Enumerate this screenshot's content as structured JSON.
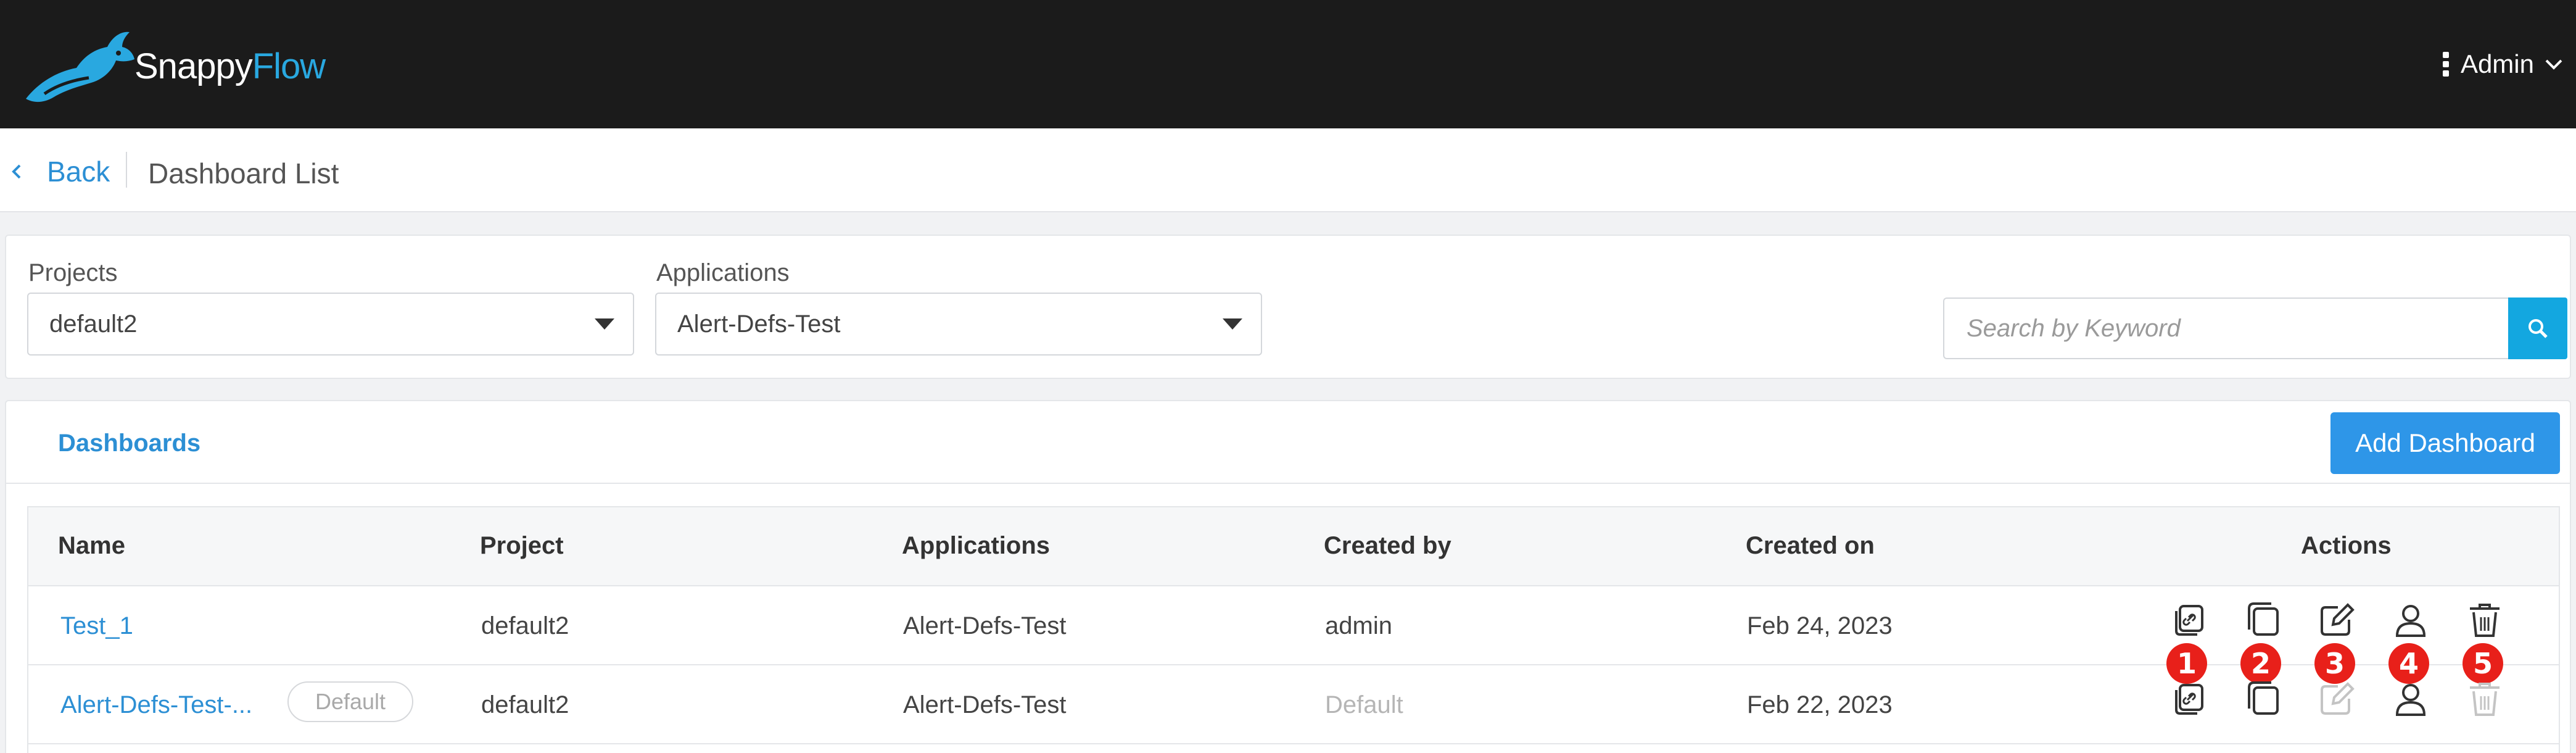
{
  "header": {
    "brand_part1": "Snappy",
    "brand_part2": "Flow",
    "user_label": "Admin"
  },
  "breadcrumb": {
    "back_label": "Back",
    "page_title": "Dashboard List"
  },
  "filters": {
    "projects_label": "Projects",
    "projects_value": "default2",
    "applications_label": "Applications",
    "applications_value": "Alert-Defs-Test",
    "search_placeholder": "Search by Keyword"
  },
  "dashboards": {
    "tab_label": "Dashboards",
    "add_button_label": "Add Dashboard",
    "columns": [
      "Name",
      "Project",
      "Applications",
      "Created by",
      "Created on",
      "Actions"
    ],
    "rows": [
      {
        "name": "Test_1",
        "badge": "",
        "project": "default2",
        "applications": "Alert-Defs-Test",
        "created_by": "admin",
        "created_on": "Feb 24, 2023"
      },
      {
        "name": "Alert-Defs-Test-...",
        "badge": "Default",
        "project": "default2",
        "applications": "Alert-Defs-Test",
        "created_by": "Default",
        "created_on": "Feb 22, 2023"
      }
    ],
    "action_icons": [
      "copy-link-icon",
      "duplicate-icon",
      "edit-icon",
      "user-icon",
      "delete-icon"
    ],
    "action_markers": [
      "1",
      "2",
      "3",
      "4",
      "5"
    ]
  },
  "colors": {
    "navbar": "#1b1b1b",
    "accent": "#2c8fd4",
    "search_button": "#13a7e0",
    "add_button": "#2e96e8",
    "marker": "#e8201a"
  }
}
